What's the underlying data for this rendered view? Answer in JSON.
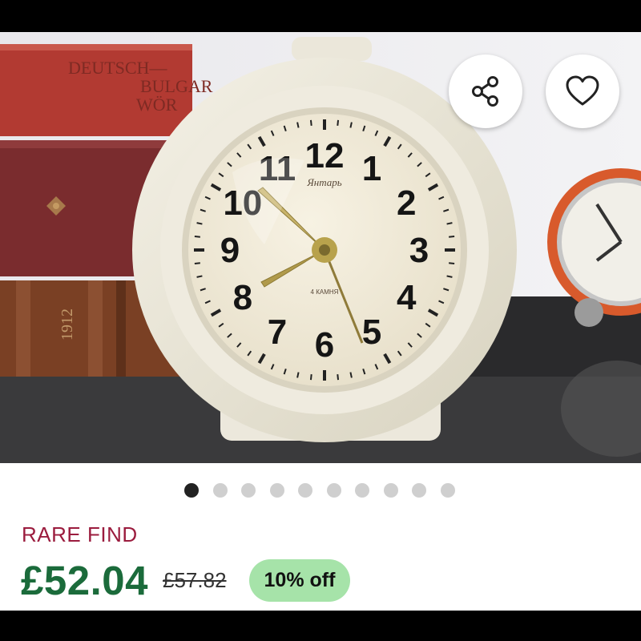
{
  "product": {
    "badge": "RARE FIND",
    "price": "£52.04",
    "original_price": "£57.82",
    "discount": "10% off"
  },
  "gallery": {
    "image_count": 10,
    "active_index": 0,
    "clock_face": {
      "brand": "Янтарь",
      "movement": "4 КАМНЯ",
      "hour_numbers": [
        "12",
        "1",
        "2",
        "3",
        "4",
        "5",
        "6",
        "7",
        "8",
        "9",
        "10",
        "11"
      ]
    },
    "book_spine_text": [
      "DEUTSCH—",
      "BULGAR",
      "WÖR",
      "1912"
    ]
  },
  "icons": {
    "share": "share-icon",
    "favorite": "heart-icon"
  },
  "colors": {
    "badge": "#9b1c3e",
    "price": "#1b6b3b",
    "discount_bg": "#a6e3a9"
  }
}
